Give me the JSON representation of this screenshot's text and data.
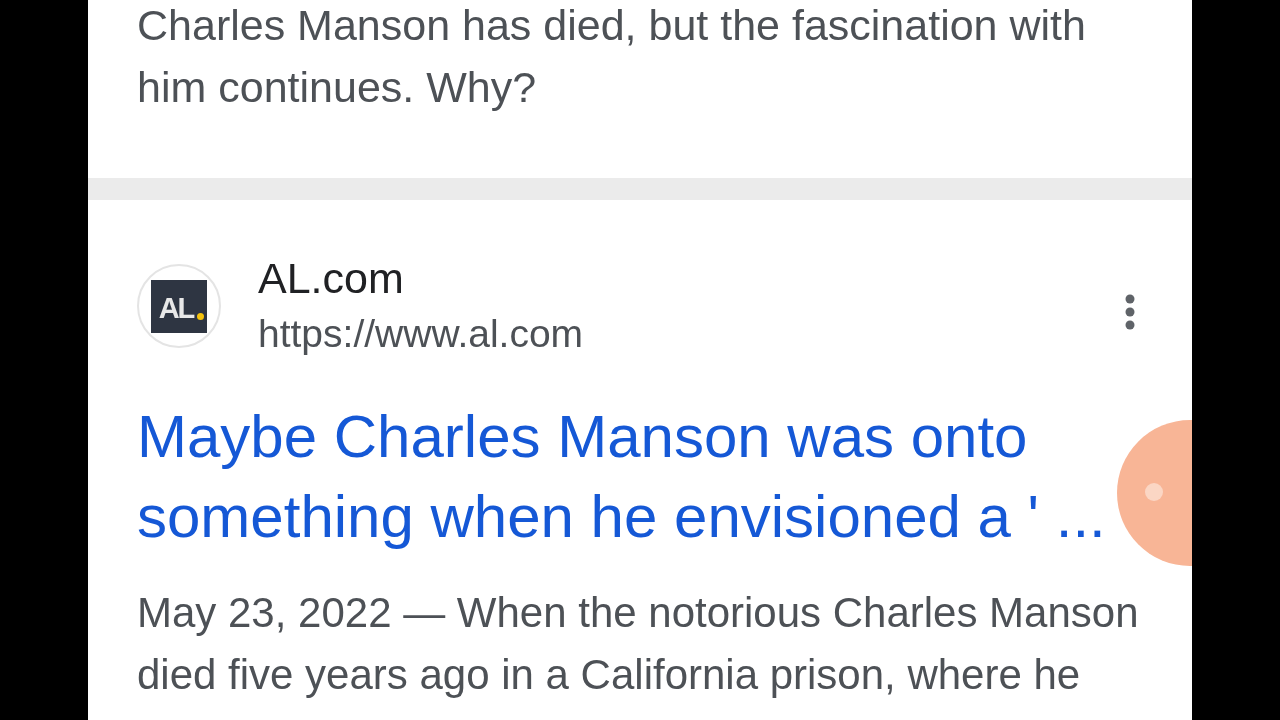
{
  "previous_result": {
    "snippet": "Charles Manson has died, but the fascination with him continues. Why?"
  },
  "result": {
    "logo_text": "AL",
    "site_name": "AL.com",
    "url": "https://www.al.com",
    "title": "Maybe Charles Manson was onto something when he envisioned a ' ...",
    "snippet": "May 23, 2022 — When the notorious Charles Manson died five years ago in a California prison, where he"
  }
}
